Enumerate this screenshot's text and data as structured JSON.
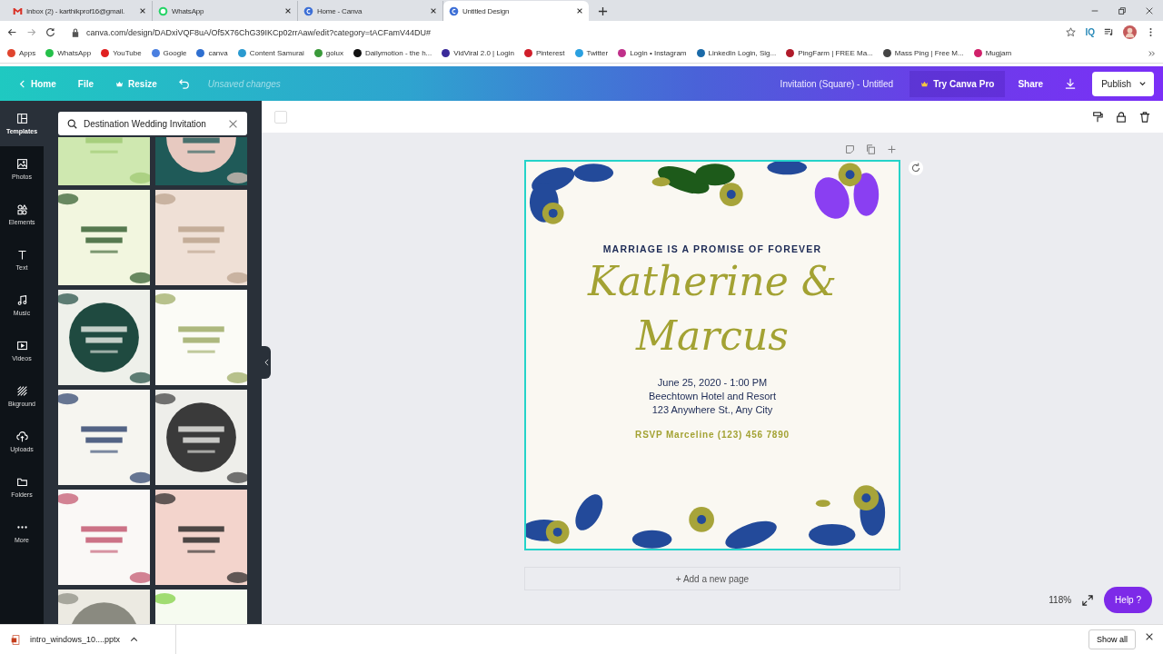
{
  "browser": {
    "tabs": [
      {
        "title": "Inbox (2) - karthikprof16@gmail.",
        "selected": false
      },
      {
        "title": "WhatsApp",
        "selected": false
      },
      {
        "title": "Home - Canva",
        "selected": false
      },
      {
        "title": "Untitled Design",
        "selected": true
      }
    ],
    "url": "canva.com/design/DADxiVQF8uA/Of5X76ChG39IKCp02rrAaw/edit?category=tACFamV44DU#",
    "extension": "IQ",
    "bookmarks": [
      {
        "label": "Apps",
        "color": "#e0442e"
      },
      {
        "label": "WhatsApp",
        "color": "#25c04a"
      },
      {
        "label": "YouTube",
        "color": "#e02020"
      },
      {
        "label": "Google",
        "color": "#4a7fe0"
      },
      {
        "label": "canva",
        "color": "#2f6fd0"
      },
      {
        "label": "Content Samurai",
        "color": "#2a9ad0"
      },
      {
        "label": "golux",
        "color": "#3a9a3a"
      },
      {
        "label": "Dailymotion - the h...",
        "color": "#111111"
      },
      {
        "label": "VidViral 2.0 | Login",
        "color": "#3a2a9a"
      },
      {
        "label": "Pinterest",
        "color": "#d01e2a"
      },
      {
        "label": "Twitter",
        "color": "#2aa0e0"
      },
      {
        "label": "Login • Instagram",
        "color": "#c0308a"
      },
      {
        "label": "LinkedIn Login, Sig...",
        "color": "#1a6aa8"
      },
      {
        "label": "PingFarm | FREE Ma...",
        "color": "#b01a2a"
      },
      {
        "label": "Mass Ping | Free M...",
        "color": "#444444"
      },
      {
        "label": "Mugjam",
        "color": "#d0206a"
      }
    ]
  },
  "toolbar": {
    "home": "Home",
    "file": "File",
    "resize": "Resize",
    "status": "Unsaved changes",
    "title": "Invitation (Square) - Untitled",
    "try_pro": "Try Canva Pro",
    "share": "Share",
    "publish": "Publish"
  },
  "sidebar": {
    "items": [
      {
        "label": "Templates",
        "selected": true
      },
      {
        "label": "Photos",
        "selected": false
      },
      {
        "label": "Elements",
        "selected": false
      },
      {
        "label": "Text",
        "selected": false
      },
      {
        "label": "Music",
        "selected": false
      },
      {
        "label": "Videos",
        "selected": false
      },
      {
        "label": "Bkground",
        "selected": false
      },
      {
        "label": "Uploads",
        "selected": false
      },
      {
        "label": "Folders",
        "selected": false
      },
      {
        "label": "More",
        "selected": false
      }
    ]
  },
  "search": {
    "value": "Destination Wedding Invitation"
  },
  "design": {
    "selected": true,
    "tagline": "MARRIAGE IS A PROMISE OF FOREVER",
    "names": [
      "Katherine &",
      "Marcus"
    ],
    "details": [
      "June 25, 2020 - 1:00 PM",
      "Beechtown Hotel and Resort",
      "123 Anywhere St., Any City"
    ],
    "rsvp": "RSVP Marceline (123) 456 7890"
  },
  "add_page": "+ Add a new page",
  "zoom": "118%",
  "help": {
    "label": "Help",
    "mark": "?"
  },
  "downloads": {
    "file": "intro_windows_10....pptx",
    "show_all": "Show all"
  }
}
